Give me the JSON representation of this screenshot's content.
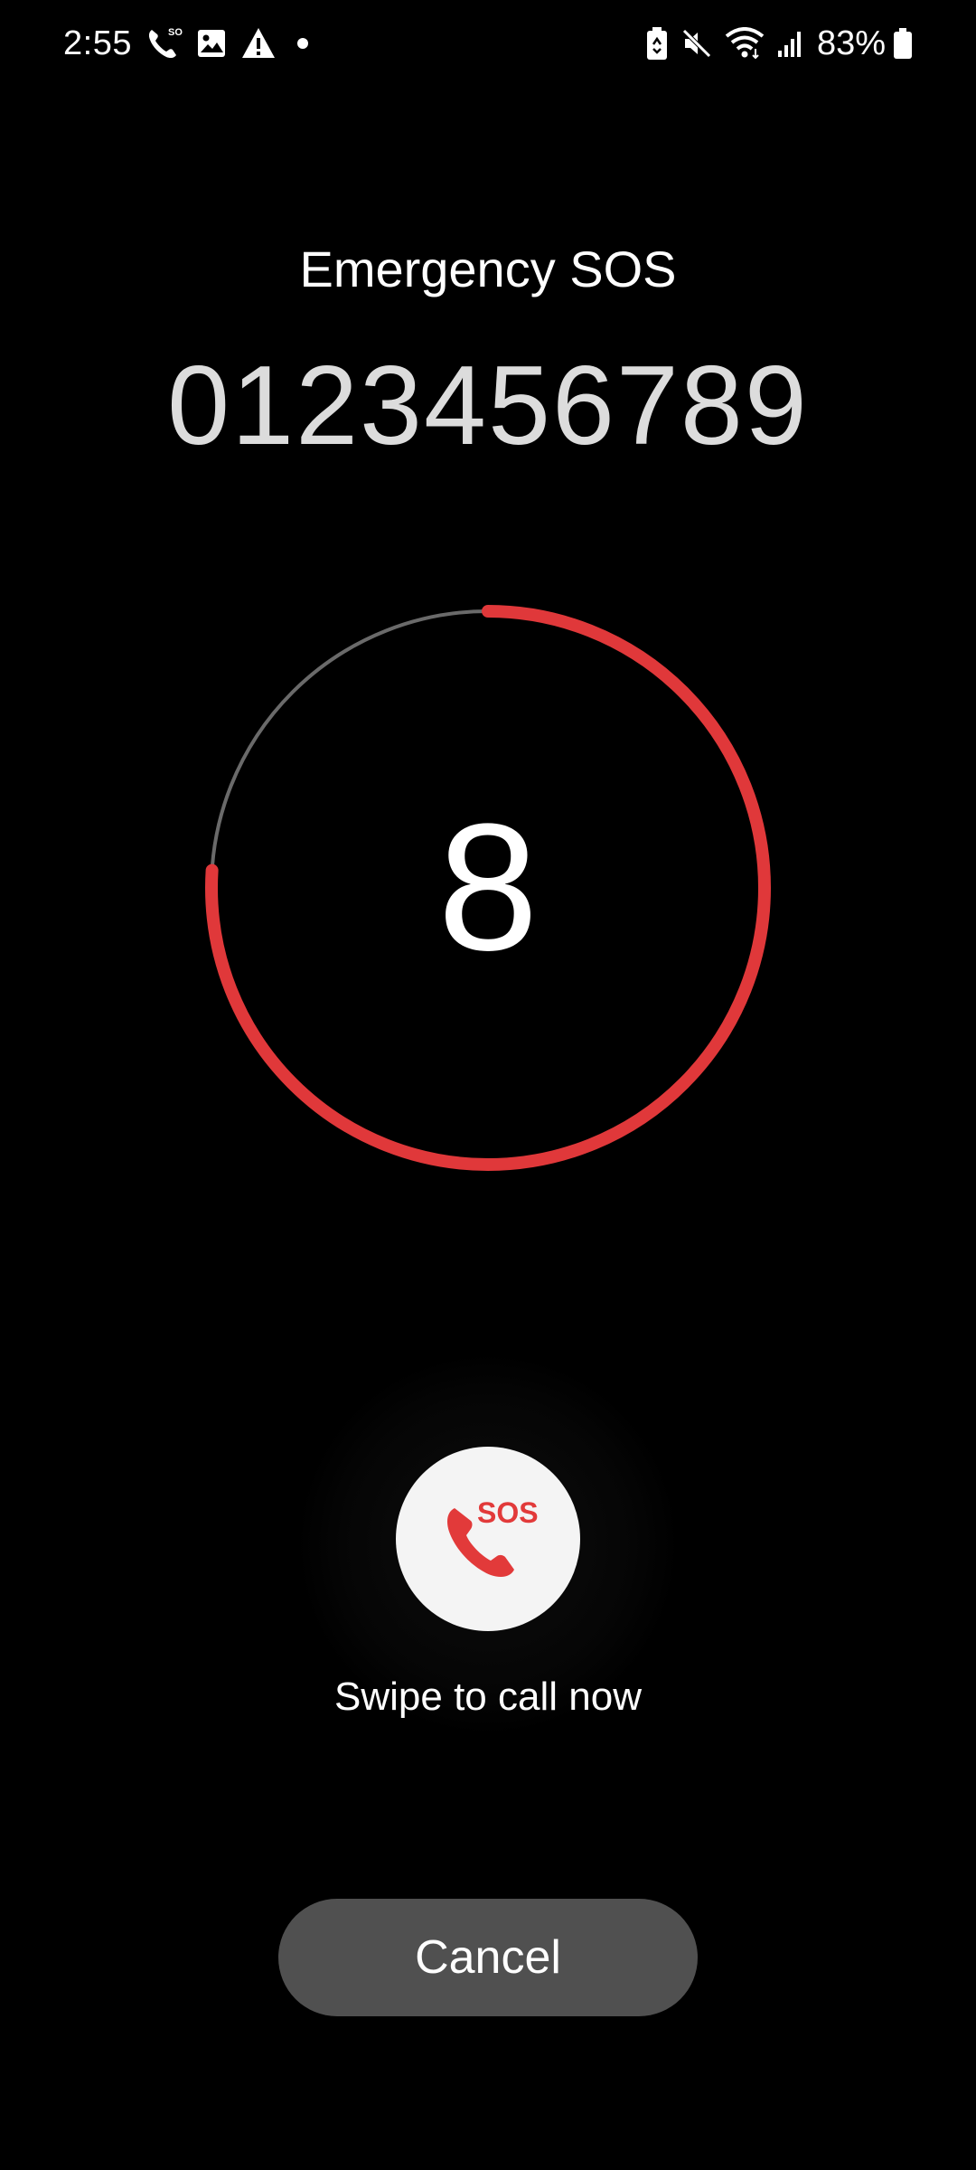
{
  "status_bar": {
    "time": "2:55",
    "battery_percent": "83%",
    "left_icons": [
      "phone-sos-icon",
      "image-icon",
      "warning-icon",
      "dot-icon"
    ],
    "right_icons": [
      "battery-saver-icon",
      "mute-icon",
      "wifi-icon",
      "signal-icon",
      "battery-icon"
    ]
  },
  "header": {
    "title": "Emergency SOS",
    "number": "0123456789"
  },
  "countdown": {
    "value": "8",
    "progress_fraction": 0.76,
    "colors": {
      "progress": "#e0383a",
      "track": "#6a6a6a"
    }
  },
  "sos_button": {
    "label": "SOS",
    "icon": "phone-icon",
    "accent_color": "#e23a3a"
  },
  "swipe": {
    "text": "Swipe to call now"
  },
  "cancel": {
    "label": "Cancel"
  }
}
